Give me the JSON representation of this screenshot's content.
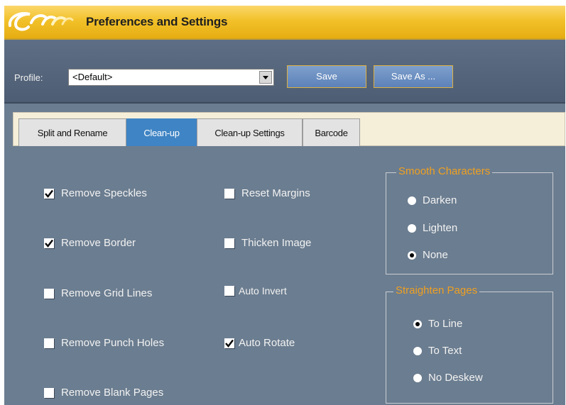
{
  "window": {
    "title": "Preferences and Settings",
    "logo_icon": "curl-swirl-logo"
  },
  "profile": {
    "label": "Profile:",
    "selected": "<Default>",
    "save_label": "Save",
    "save_as_label": "Save As ..."
  },
  "tabs": [
    {
      "label": "Split and Rename",
      "active": false
    },
    {
      "label": "Clean-up",
      "active": true
    },
    {
      "label": "Clean-up Settings",
      "active": false
    },
    {
      "label": "Barcode",
      "active": false
    }
  ],
  "cleanup": {
    "column1": [
      {
        "label": "Remove Speckles",
        "checked": true
      },
      {
        "label": "Remove Border",
        "checked": true
      },
      {
        "label": "Remove Grid Lines",
        "checked": false
      },
      {
        "label": "Remove Punch Holes",
        "checked": false
      },
      {
        "label": "Remove Blank Pages",
        "checked": false
      }
    ],
    "column2": [
      {
        "label": "Reset Margins",
        "checked": false
      },
      {
        "label": "Thicken Image",
        "checked": false
      },
      {
        "label": "Auto Invert",
        "checked": false
      },
      {
        "label": "Auto Rotate",
        "checked": true
      }
    ],
    "smooth_characters": {
      "legend": "Smooth Characters",
      "options": [
        {
          "label": "Darken",
          "selected": false
        },
        {
          "label": "Lighten",
          "selected": false
        },
        {
          "label": "None",
          "selected": true
        }
      ]
    },
    "straighten_pages": {
      "legend": "Straighten Pages",
      "options": [
        {
          "label": "To Line",
          "selected": true
        },
        {
          "label": "To Text",
          "selected": false
        },
        {
          "label": "No Deskew",
          "selected": false
        }
      ]
    }
  },
  "colors": {
    "titlebar": "#f2c12a",
    "panel": "#6b7d90",
    "active_tab": "#3f84c4",
    "legend_text": "#f0a020"
  }
}
